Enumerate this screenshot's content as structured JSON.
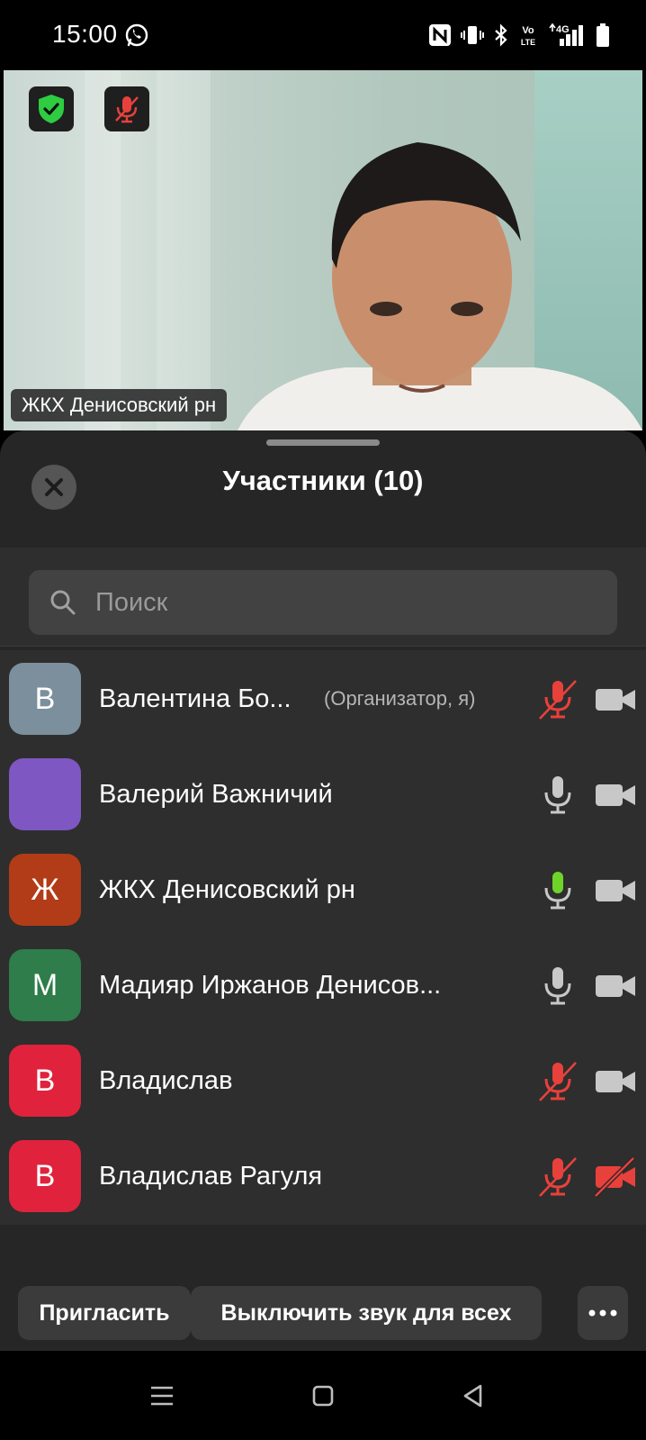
{
  "status_bar": {
    "time": "15:00",
    "icons": [
      "whatsapp-icon",
      "nfc-icon",
      "vibrate-icon",
      "bluetooth-icon",
      "volte-icon",
      "4g-icon",
      "signal-icon",
      "battery-icon"
    ],
    "volte_label": "Vo LTE",
    "network_label": "4G"
  },
  "video": {
    "participant_name": "ЖКХ Денисовский рн",
    "security_icon": "shield-check-icon",
    "mic_icon": "mic-muted-icon"
  },
  "sheet": {
    "title": "Участники (10)",
    "close_icon": "close-icon",
    "search_placeholder": "Поиск",
    "participants": [
      {
        "initial": "B",
        "name": "Валентина Бо...",
        "role": "(Организатор, я)",
        "avatar_color": "#7c8f9c",
        "mic": "muted",
        "video": "on"
      },
      {
        "initial": "",
        "name": "Валерий Важничий",
        "role": "",
        "avatar_color": "#7e57c2",
        "mic": "on",
        "video": "on"
      },
      {
        "initial": "Ж",
        "name": "ЖКХ Денисовский рн",
        "role": "",
        "avatar_color": "#b23c17",
        "mic": "speaking",
        "video": "on"
      },
      {
        "initial": "M",
        "name": "Мадияр Иржанов Денисов...",
        "role": "",
        "avatar_color": "#2e7d4a",
        "mic": "on",
        "video": "on"
      },
      {
        "initial": "B",
        "name": "Владислав",
        "role": "",
        "avatar_color": "#e0223c",
        "mic": "muted",
        "video": "on"
      },
      {
        "initial": "B",
        "name": "Владислав Рагуля",
        "role": "",
        "avatar_color": "#e0223c",
        "mic": "muted",
        "video": "off"
      }
    ],
    "buttons": {
      "invite": "Пригласить",
      "mute_all": "Выключить звук для всех",
      "more": "•••"
    }
  },
  "colors": {
    "muted_red": "#e8413c",
    "speaking_green": "#6fd42a",
    "icon_gray": "#c8c8c8"
  }
}
